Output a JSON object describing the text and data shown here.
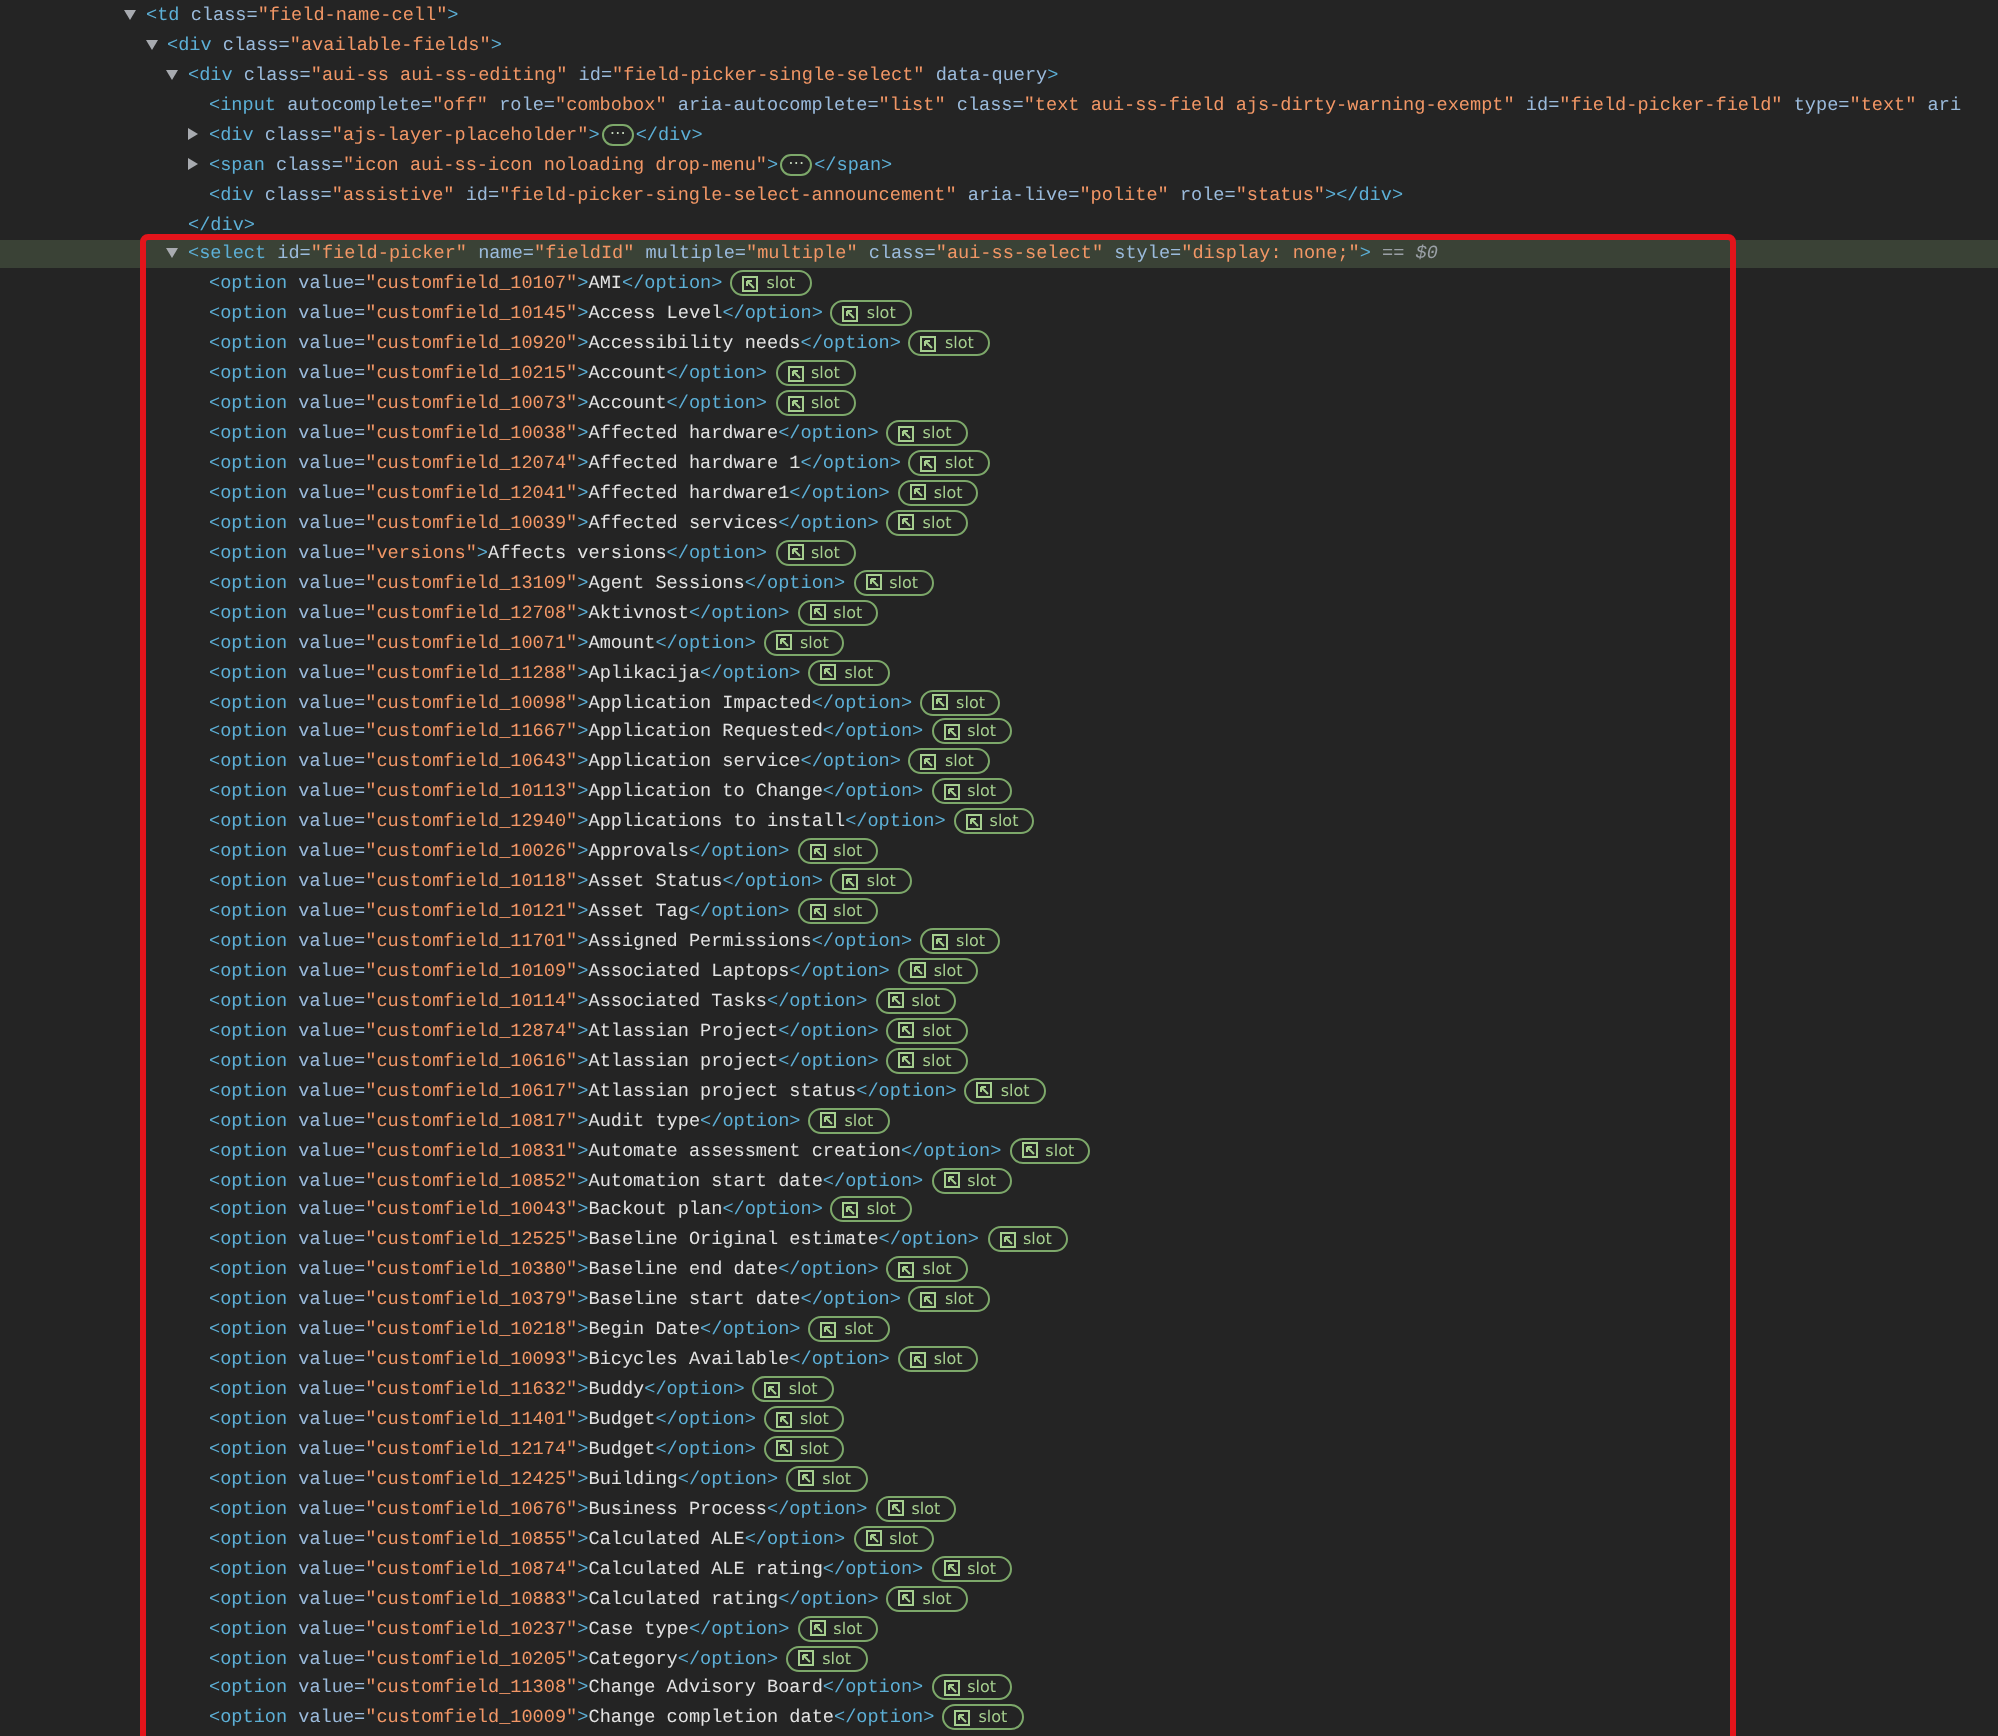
{
  "tree": [
    {
      "kind": "element",
      "expanded": true,
      "selected": false,
      "tokens": [
        {
          "kind": "tag",
          "text": "<td"
        },
        {
          "kind": "attr",
          "text": " class="
        },
        {
          "kind": "value",
          "text": "\"field-name-cell\""
        },
        {
          "kind": "tag",
          "text": ">"
        }
      ],
      "children": [
        {
          "kind": "element",
          "expanded": true,
          "selected": false,
          "tokens": [
            {
              "kind": "tag",
              "text": "<div"
            },
            {
              "kind": "attr",
              "text": " class="
            },
            {
              "kind": "value",
              "text": "\"available-fields\""
            },
            {
              "kind": "tag",
              "text": ">"
            }
          ],
          "children": [
            {
              "kind": "element",
              "expanded": true,
              "selected": false,
              "tokens": [
                {
                  "kind": "tag",
                  "text": "<div"
                },
                {
                  "kind": "attr",
                  "text": " class="
                },
                {
                  "kind": "value",
                  "text": "\"aui-ss aui-ss-editing\""
                },
                {
                  "kind": "attr",
                  "text": " id="
                },
                {
                  "kind": "value",
                  "text": "\"field-picker-single-select\""
                },
                {
                  "kind": "attr",
                  "text": " data-query"
                },
                {
                  "kind": "tag",
                  "text": ">"
                }
              ],
              "children": [
                {
                  "kind": "element",
                  "selected": false,
                  "tokens": [
                    {
                      "kind": "tag",
                      "text": "<input"
                    },
                    {
                      "kind": "attr",
                      "text": " autocomplete="
                    },
                    {
                      "kind": "value",
                      "text": "\"off\""
                    },
                    {
                      "kind": "attr",
                      "text": " role="
                    },
                    {
                      "kind": "value",
                      "text": "\"combobox\""
                    },
                    {
                      "kind": "attr",
                      "text": " aria-autocomplete="
                    },
                    {
                      "kind": "value",
                      "text": "\"list\""
                    },
                    {
                      "kind": "attr",
                      "text": " class="
                    },
                    {
                      "kind": "value",
                      "text": "\"text aui-ss-field ajs-dirty-warning-exempt\""
                    },
                    {
                      "kind": "attr",
                      "text": " id="
                    },
                    {
                      "kind": "value",
                      "text": "\"field-picker-field\""
                    },
                    {
                      "kind": "attr",
                      "text": " type="
                    },
                    {
                      "kind": "value",
                      "text": "\"text\""
                    },
                    {
                      "kind": "attr",
                      "text": " ari"
                    }
                  ]
                },
                {
                  "kind": "element",
                  "expanded": false,
                  "selected": false,
                  "tokens": [
                    {
                      "kind": "tag",
                      "text": "<div"
                    },
                    {
                      "kind": "attr",
                      "text": " class="
                    },
                    {
                      "kind": "value",
                      "text": "\"ajs-layer-placeholder\""
                    },
                    {
                      "kind": "tag",
                      "text": ">"
                    },
                    {
                      "kind": "ellipsis",
                      "text": "⋯"
                    },
                    {
                      "kind": "tag",
                      "text": "</div>"
                    }
                  ]
                },
                {
                  "kind": "element",
                  "expanded": false,
                  "selected": false,
                  "tokens": [
                    {
                      "kind": "tag",
                      "text": "<span"
                    },
                    {
                      "kind": "attr",
                      "text": " class="
                    },
                    {
                      "kind": "value",
                      "text": "\"icon aui-ss-icon noloading drop-menu\""
                    },
                    {
                      "kind": "tag",
                      "text": ">"
                    },
                    {
                      "kind": "ellipsis",
                      "text": "⋯"
                    },
                    {
                      "kind": "tag",
                      "text": "</span>"
                    }
                  ]
                },
                {
                  "kind": "element",
                  "selected": false,
                  "tokens": [
                    {
                      "kind": "tag",
                      "text": "<div"
                    },
                    {
                      "kind": "attr",
                      "text": " class="
                    },
                    {
                      "kind": "value",
                      "text": "\"assistive\""
                    },
                    {
                      "kind": "attr",
                      "text": " id="
                    },
                    {
                      "kind": "value",
                      "text": "\"field-picker-single-select-announcement\""
                    },
                    {
                      "kind": "attr",
                      "text": " aria-live="
                    },
                    {
                      "kind": "value",
                      "text": "\"polite\""
                    },
                    {
                      "kind": "attr",
                      "text": " role="
                    },
                    {
                      "kind": "value",
                      "text": "\"status\""
                    },
                    {
                      "kind": "tag",
                      "text": "></div>"
                    }
                  ]
                }
              ],
              "closing": [
                {
                  "kind": "tag",
                  "text": "</div>"
                }
              ]
            },
            {
              "kind": "element",
              "expanded": true,
              "selected": true,
              "outlined": true,
              "tokens": [
                {
                  "kind": "tag",
                  "text": "<select"
                },
                {
                  "kind": "attr",
                  "text": " id="
                },
                {
                  "kind": "value",
                  "text": "\"field-picker\""
                },
                {
                  "kind": "attr",
                  "text": " name="
                },
                {
                  "kind": "value",
                  "text": "\"fieldId\""
                },
                {
                  "kind": "attr",
                  "text": " multiple="
                },
                {
                  "kind": "value",
                  "text": "\"multiple\""
                },
                {
                  "kind": "attr",
                  "text": " class="
                },
                {
                  "kind": "value",
                  "text": "\"aui-ss-select\""
                },
                {
                  "kind": "attr",
                  "text": " style="
                },
                {
                  "kind": "value",
                  "text": "\"display: none;\""
                },
                {
                  "kind": "tag",
                  "text": ">"
                },
                {
                  "kind": "note",
                  "text": " == *$0*"
                }
              ],
              "children": [
                {
                  "kind": "option",
                  "selected": false,
                  "tag": "<option",
                  "attribute": " value=",
                  "attr_value": "\"customfield_10107\"",
                  "tag_end": ">",
                  "content": "AMI",
                  "close": "</option>",
                  "badge": "slot"
                },
                {
                  "kind": "option",
                  "selected": false,
                  "tag": "<option",
                  "attribute": " value=",
                  "attr_value": "\"customfield_10145\"",
                  "tag_end": ">",
                  "content": "Access Level",
                  "close": "</option>",
                  "badge": "slot"
                },
                {
                  "kind": "option",
                  "selected": false,
                  "tag": "<option",
                  "attribute": " value=",
                  "attr_value": "\"customfield_10920\"",
                  "tag_end": ">",
                  "content": "Accessibility needs",
                  "close": "</option>",
                  "badge": "slot"
                },
                {
                  "kind": "option",
                  "selected": false,
                  "tag": "<option",
                  "attribute": " value=",
                  "attr_value": "\"customfield_10215\"",
                  "tag_end": ">",
                  "content": "Account",
                  "close": "</option>",
                  "badge": "slot"
                },
                {
                  "kind": "option",
                  "selected": false,
                  "tag": "<option",
                  "attribute": " value=",
                  "attr_value": "\"customfield_10073\"",
                  "tag_end": ">",
                  "content": "Account",
                  "close": "</option>",
                  "badge": "slot"
                },
                {
                  "kind": "option",
                  "selected": false,
                  "tag": "<option",
                  "attribute": " value=",
                  "attr_value": "\"customfield_10038\"",
                  "tag_end": ">",
                  "content": "Affected hardware",
                  "close": "</option>",
                  "badge": "slot"
                },
                {
                  "kind": "option",
                  "selected": false,
                  "tag": "<option",
                  "attribute": " value=",
                  "attr_value": "\"customfield_12074\"",
                  "tag_end": ">",
                  "content": "Affected hardware 1",
                  "close": "</option>",
                  "badge": "slot"
                },
                {
                  "kind": "option",
                  "selected": false,
                  "tag": "<option",
                  "attribute": " value=",
                  "attr_value": "\"customfield_12041\"",
                  "tag_end": ">",
                  "content": "Affected hardware1",
                  "close": "</option>",
                  "badge": "slot"
                },
                {
                  "kind": "option",
                  "selected": false,
                  "tag": "<option",
                  "attribute": " value=",
                  "attr_value": "\"customfield_10039\"",
                  "tag_end": ">",
                  "content": "Affected services",
                  "close": "</option>",
                  "badge": "slot"
                },
                {
                  "kind": "option",
                  "selected": false,
                  "tag": "<option",
                  "attribute": " value=",
                  "attr_value": "\"versions\"",
                  "tag_end": ">",
                  "content": "Affects versions",
                  "close": "</option>",
                  "badge": "slot"
                },
                {
                  "kind": "option",
                  "selected": false,
                  "tag": "<option",
                  "attribute": " value=",
                  "attr_value": "\"customfield_13109\"",
                  "tag_end": ">",
                  "content": "Agent Sessions",
                  "close": "</option>",
                  "badge": "slot"
                },
                {
                  "kind": "option",
                  "selected": false,
                  "tag": "<option",
                  "attribute": " value=",
                  "attr_value": "\"customfield_12708\"",
                  "tag_end": ">",
                  "content": "Aktivnost",
                  "close": "</option>",
                  "badge": "slot"
                },
                {
                  "kind": "option",
                  "selected": false,
                  "tag": "<option",
                  "attribute": " value=",
                  "attr_value": "\"customfield_10071\"",
                  "tag_end": ">",
                  "content": "Amount",
                  "close": "</option>",
                  "badge": "slot"
                },
                {
                  "kind": "option",
                  "selected": false,
                  "tag": "<option",
                  "attribute": " value=",
                  "attr_value": "\"customfield_11288\"",
                  "tag_end": ">",
                  "content": "Aplikacija",
                  "close": "</option>",
                  "badge": "slot"
                },
                {
                  "kind": "option",
                  "selected": false,
                  "tag": "<option",
                  "attribute": " value=",
                  "attr_value": "\"customfield_10098\"",
                  "tag_end": ">",
                  "content": "Application Impacted",
                  "close": "</option>",
                  "badge": "slot"
                },
                {
                  "kind": "option",
                  "selected": false,
                  "tag": "<option",
                  "attribute": " value=",
                  "attr_value": "\"customfield_11667\"",
                  "tag_end": ">",
                  "content": "Application Requested",
                  "close": "</option>",
                  "badge": "slot"
                },
                {
                  "kind": "option",
                  "selected": false,
                  "tag": "<option",
                  "attribute": " value=",
                  "attr_value": "\"customfield_10643\"",
                  "tag_end": ">",
                  "content": "Application service",
                  "close": "</option>",
                  "badge": "slot"
                },
                {
                  "kind": "option",
                  "selected": false,
                  "tag": "<option",
                  "attribute": " value=",
                  "attr_value": "\"customfield_10113\"",
                  "tag_end": ">",
                  "content": "Application to Change",
                  "close": "</option>",
                  "badge": "slot"
                },
                {
                  "kind": "option",
                  "selected": false,
                  "tag": "<option",
                  "attribute": " value=",
                  "attr_value": "\"customfield_12940\"",
                  "tag_end": ">",
                  "content": "Applications to install",
                  "close": "</option>",
                  "badge": "slot"
                },
                {
                  "kind": "option",
                  "selected": false,
                  "tag": "<option",
                  "attribute": " value=",
                  "attr_value": "\"customfield_10026\"",
                  "tag_end": ">",
                  "content": "Approvals",
                  "close": "</option>",
                  "badge": "slot"
                },
                {
                  "kind": "option",
                  "selected": false,
                  "tag": "<option",
                  "attribute": " value=",
                  "attr_value": "\"customfield_10118\"",
                  "tag_end": ">",
                  "content": "Asset Status",
                  "close": "</option>",
                  "badge": "slot"
                },
                {
                  "kind": "option",
                  "selected": false,
                  "tag": "<option",
                  "attribute": " value=",
                  "attr_value": "\"customfield_10121\"",
                  "tag_end": ">",
                  "content": "Asset Tag",
                  "close": "</option>",
                  "badge": "slot"
                },
                {
                  "kind": "option",
                  "selected": false,
                  "tag": "<option",
                  "attribute": " value=",
                  "attr_value": "\"customfield_11701\"",
                  "tag_end": ">",
                  "content": "Assigned Permissions",
                  "close": "</option>",
                  "badge": "slot"
                },
                {
                  "kind": "option",
                  "selected": false,
                  "tag": "<option",
                  "attribute": " value=",
                  "attr_value": "\"customfield_10109\"",
                  "tag_end": ">",
                  "content": "Associated Laptops",
                  "close": "</option>",
                  "badge": "slot"
                },
                {
                  "kind": "option",
                  "selected": false,
                  "tag": "<option",
                  "attribute": " value=",
                  "attr_value": "\"customfield_10114\"",
                  "tag_end": ">",
                  "content": "Associated Tasks",
                  "close": "</option>",
                  "badge": "slot"
                },
                {
                  "kind": "option",
                  "selected": false,
                  "tag": "<option",
                  "attribute": " value=",
                  "attr_value": "\"customfield_12874\"",
                  "tag_end": ">",
                  "content": "Atlassian Project",
                  "close": "</option>",
                  "badge": "slot"
                },
                {
                  "kind": "option",
                  "selected": false,
                  "tag": "<option",
                  "attribute": " value=",
                  "attr_value": "\"customfield_10616\"",
                  "tag_end": ">",
                  "content": "Atlassian project",
                  "close": "</option>",
                  "badge": "slot"
                },
                {
                  "kind": "option",
                  "selected": false,
                  "tag": "<option",
                  "attribute": " value=",
                  "attr_value": "\"customfield_10617\"",
                  "tag_end": ">",
                  "content": "Atlassian project status",
                  "close": "</option>",
                  "badge": "slot"
                },
                {
                  "kind": "option",
                  "selected": false,
                  "tag": "<option",
                  "attribute": " value=",
                  "attr_value": "\"customfield_10817\"",
                  "tag_end": ">",
                  "content": "Audit type",
                  "close": "</option>",
                  "badge": "slot"
                },
                {
                  "kind": "option",
                  "selected": false,
                  "tag": "<option",
                  "attribute": " value=",
                  "attr_value": "\"customfield_10831\"",
                  "tag_end": ">",
                  "content": "Automate assessment creation",
                  "close": "</option>",
                  "badge": "slot"
                },
                {
                  "kind": "option",
                  "selected": false,
                  "tag": "<option",
                  "attribute": " value=",
                  "attr_value": "\"customfield_10852\"",
                  "tag_end": ">",
                  "content": "Automation start date",
                  "close": "</option>",
                  "badge": "slot"
                },
                {
                  "kind": "option",
                  "selected": false,
                  "tag": "<option",
                  "attribute": " value=",
                  "attr_value": "\"customfield_10043\"",
                  "tag_end": ">",
                  "content": "Backout plan",
                  "close": "</option>",
                  "badge": "slot"
                },
                {
                  "kind": "option",
                  "selected": false,
                  "tag": "<option",
                  "attribute": " value=",
                  "attr_value": "\"customfield_12525\"",
                  "tag_end": ">",
                  "content": "Baseline Original estimate",
                  "close": "</option>",
                  "badge": "slot"
                },
                {
                  "kind": "option",
                  "selected": false,
                  "tag": "<option",
                  "attribute": " value=",
                  "attr_value": "\"customfield_10380\"",
                  "tag_end": ">",
                  "content": "Baseline end date",
                  "close": "</option>",
                  "badge": "slot"
                },
                {
                  "kind": "option",
                  "selected": false,
                  "tag": "<option",
                  "attribute": " value=",
                  "attr_value": "\"customfield_10379\"",
                  "tag_end": ">",
                  "content": "Baseline start date",
                  "close": "</option>",
                  "badge": "slot"
                },
                {
                  "kind": "option",
                  "selected": false,
                  "tag": "<option",
                  "attribute": " value=",
                  "attr_value": "\"customfield_10218\"",
                  "tag_end": ">",
                  "content": "Begin Date",
                  "close": "</option>",
                  "badge": "slot"
                },
                {
                  "kind": "option",
                  "selected": false,
                  "tag": "<option",
                  "attribute": " value=",
                  "attr_value": "\"customfield_10093\"",
                  "tag_end": ">",
                  "content": "Bicycles Available",
                  "close": "</option>",
                  "badge": "slot"
                },
                {
                  "kind": "option",
                  "selected": false,
                  "tag": "<option",
                  "attribute": " value=",
                  "attr_value": "\"customfield_11632\"",
                  "tag_end": ">",
                  "content": "Buddy",
                  "close": "</option>",
                  "badge": "slot"
                },
                {
                  "kind": "option",
                  "selected": false,
                  "tag": "<option",
                  "attribute": " value=",
                  "attr_value": "\"customfield_11401\"",
                  "tag_end": ">",
                  "content": "Budget",
                  "close": "</option>",
                  "badge": "slot"
                },
                {
                  "kind": "option",
                  "selected": false,
                  "tag": "<option",
                  "attribute": " value=",
                  "attr_value": "\"customfield_12174\"",
                  "tag_end": ">",
                  "content": "Budget",
                  "close": "</option>",
                  "badge": "slot"
                },
                {
                  "kind": "option",
                  "selected": false,
                  "tag": "<option",
                  "attribute": " value=",
                  "attr_value": "\"customfield_12425\"",
                  "tag_end": ">",
                  "content": "Building",
                  "close": "</option>",
                  "badge": "slot"
                },
                {
                  "kind": "option",
                  "selected": false,
                  "tag": "<option",
                  "attribute": " value=",
                  "attr_value": "\"customfield_10676\"",
                  "tag_end": ">",
                  "content": "Business Process",
                  "close": "</option>",
                  "badge": "slot"
                },
                {
                  "kind": "option",
                  "selected": false,
                  "tag": "<option",
                  "attribute": " value=",
                  "attr_value": "\"customfield_10855\"",
                  "tag_end": ">",
                  "content": "Calculated ALE",
                  "close": "</option>",
                  "badge": "slot"
                },
                {
                  "kind": "option",
                  "selected": false,
                  "tag": "<option",
                  "attribute": " value=",
                  "attr_value": "\"customfield_10874\"",
                  "tag_end": ">",
                  "content": "Calculated ALE rating",
                  "close": "</option>",
                  "badge": "slot"
                },
                {
                  "kind": "option",
                  "selected": false,
                  "tag": "<option",
                  "attribute": " value=",
                  "attr_value": "\"customfield_10883\"",
                  "tag_end": ">",
                  "content": "Calculated rating",
                  "close": "</option>",
                  "badge": "slot"
                },
                {
                  "kind": "option",
                  "selected": false,
                  "tag": "<option",
                  "attribute": " value=",
                  "attr_value": "\"customfield_10237\"",
                  "tag_end": ">",
                  "content": "Case type",
                  "close": "</option>",
                  "badge": "slot"
                },
                {
                  "kind": "option",
                  "selected": false,
                  "tag": "<option",
                  "attribute": " value=",
                  "attr_value": "\"customfield_10205\"",
                  "tag_end": ">",
                  "content": "Category",
                  "close": "</option>",
                  "badge": "slot"
                },
                {
                  "kind": "option",
                  "selected": false,
                  "tag": "<option",
                  "attribute": " value=",
                  "attr_value": "\"customfield_11308\"",
                  "tag_end": ">",
                  "content": "Change Advisory Board",
                  "close": "</option>",
                  "badge": "slot"
                },
                {
                  "kind": "option",
                  "selected": false,
                  "tag": "<option",
                  "attribute": " value=",
                  "attr_value": "\"customfield_10009\"",
                  "tag_end": ">",
                  "content": "Change completion date",
                  "close": "</option>",
                  "badge": "slot"
                }
              ]
            }
          ]
        }
      ]
    }
  ]
}
